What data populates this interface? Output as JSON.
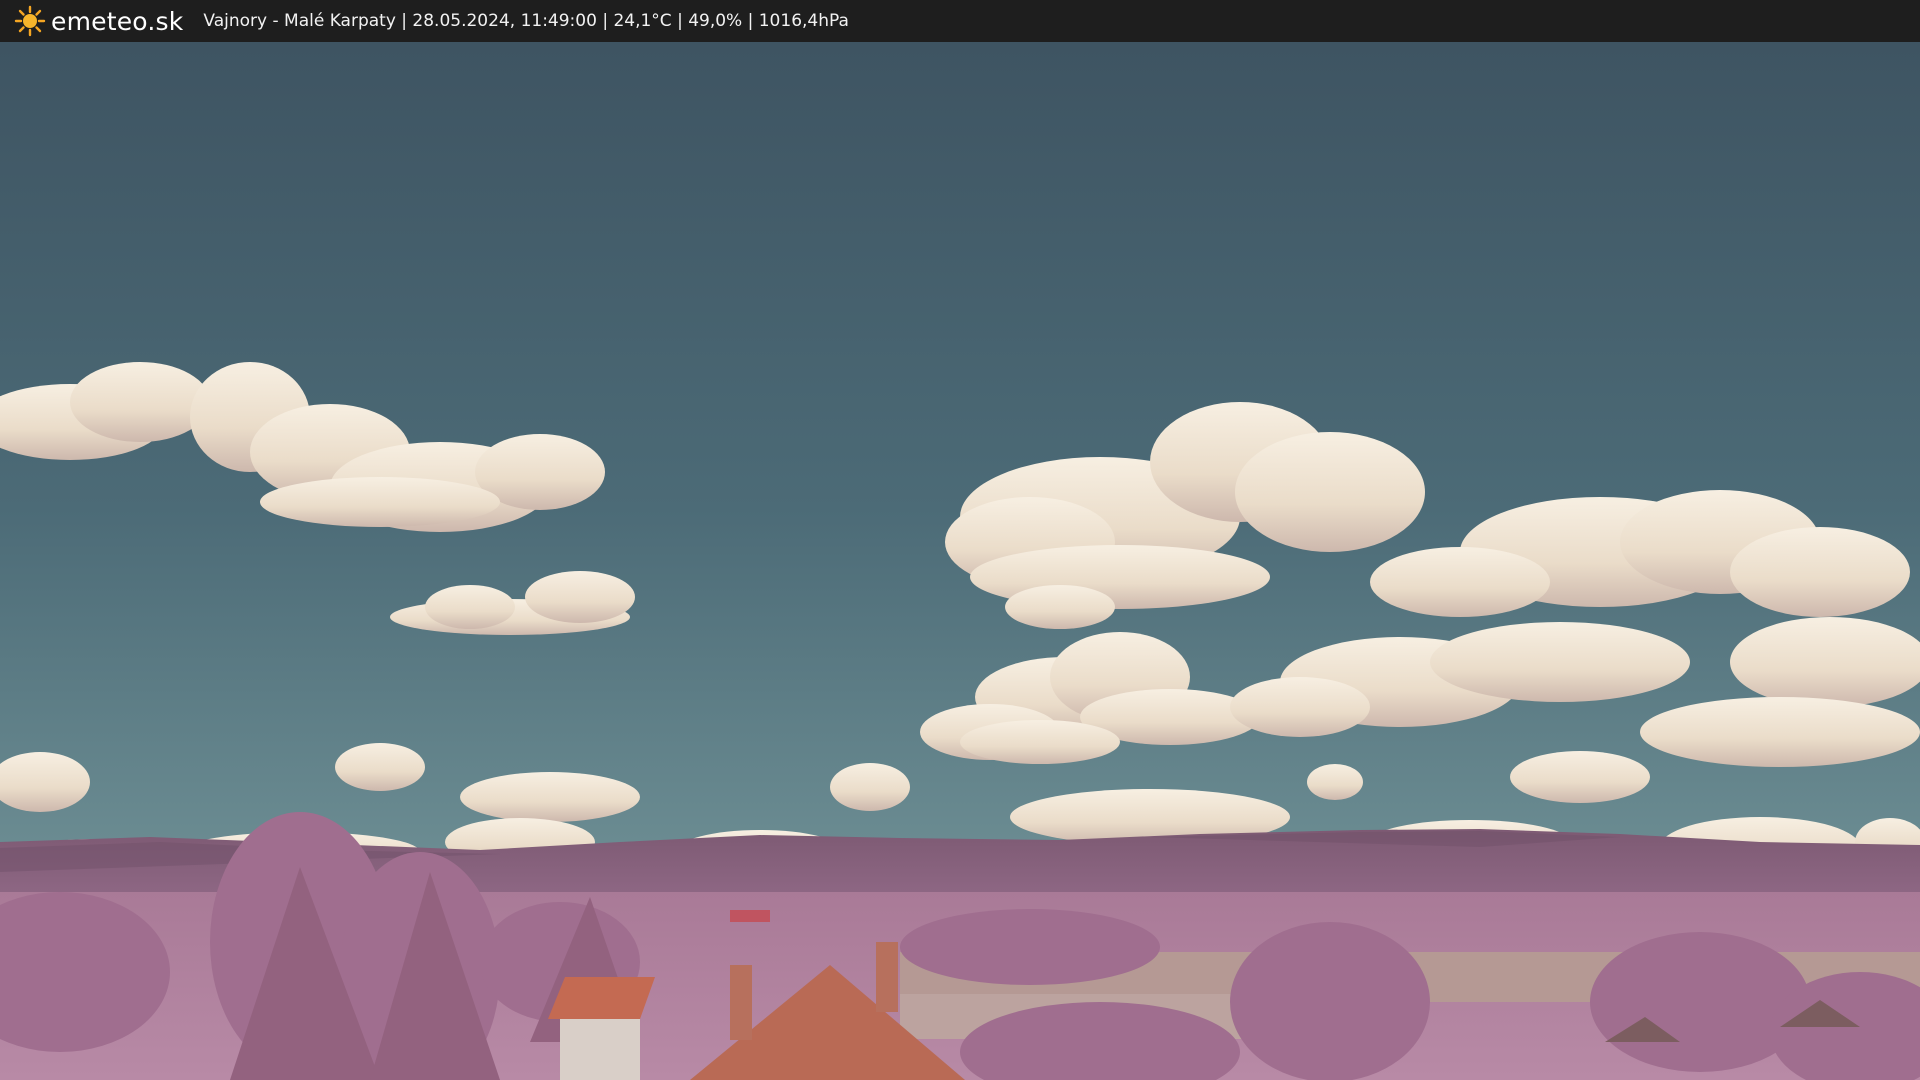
{
  "header": {
    "brand": "emeteo.sk",
    "brand_icon": "sun-icon",
    "caption": "Vajnory - Malé Karpaty | 28.05.2024, 11:49:00 | 24,1°C | 49,0% | 1016,4hPa"
  },
  "colors": {
    "header_bg": "#1e1e1e",
    "sky_top": "#3f5563",
    "sky_bottom": "#6a8c93",
    "cloud": "#efe3d2",
    "foliage": "#a97396",
    "roof": "#c46a52"
  }
}
